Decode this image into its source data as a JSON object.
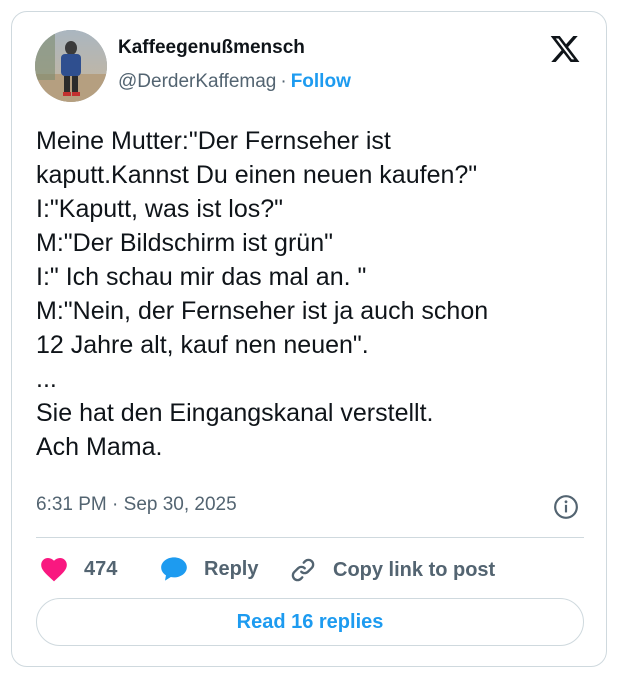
{
  "author": {
    "display_name": "Kaffeegenußmensch",
    "handle": "@DerderKaffemag",
    "separator": "·",
    "follow_label": "Follow",
    "avatar_icon": "profile-photo"
  },
  "platform_icon": "x-logo-icon",
  "tweet": {
    "lines": [
      "Meine Mutter:\"Der Fernseher ist",
      "kaputt.Kannst Du einen neuen kaufen?\"",
      "I:\"Kaputt, was ist los?\"",
      "M:\"Der Bildschirm ist grün\"",
      "I:\" Ich schau mir das mal an. \"",
      "M:\"Nein, der Fernseher ist ja auch schon",
      "12 Jahre alt, kauf nen neuen\".",
      "...",
      "Sie hat den Eingangskanal verstellt.",
      "Ach Mama."
    ],
    "timestamp": "6:31 PM · Sep 30, 2025"
  },
  "actions": {
    "like_count": "474",
    "reply_label": "Reply",
    "copy_link_label": "Copy link to post",
    "read_replies_label": "Read 16 replies"
  },
  "colors": {
    "accent": "#1d9bf0",
    "like": "#f91880",
    "secondary_text": "#536471",
    "border": "#cfd9de"
  }
}
